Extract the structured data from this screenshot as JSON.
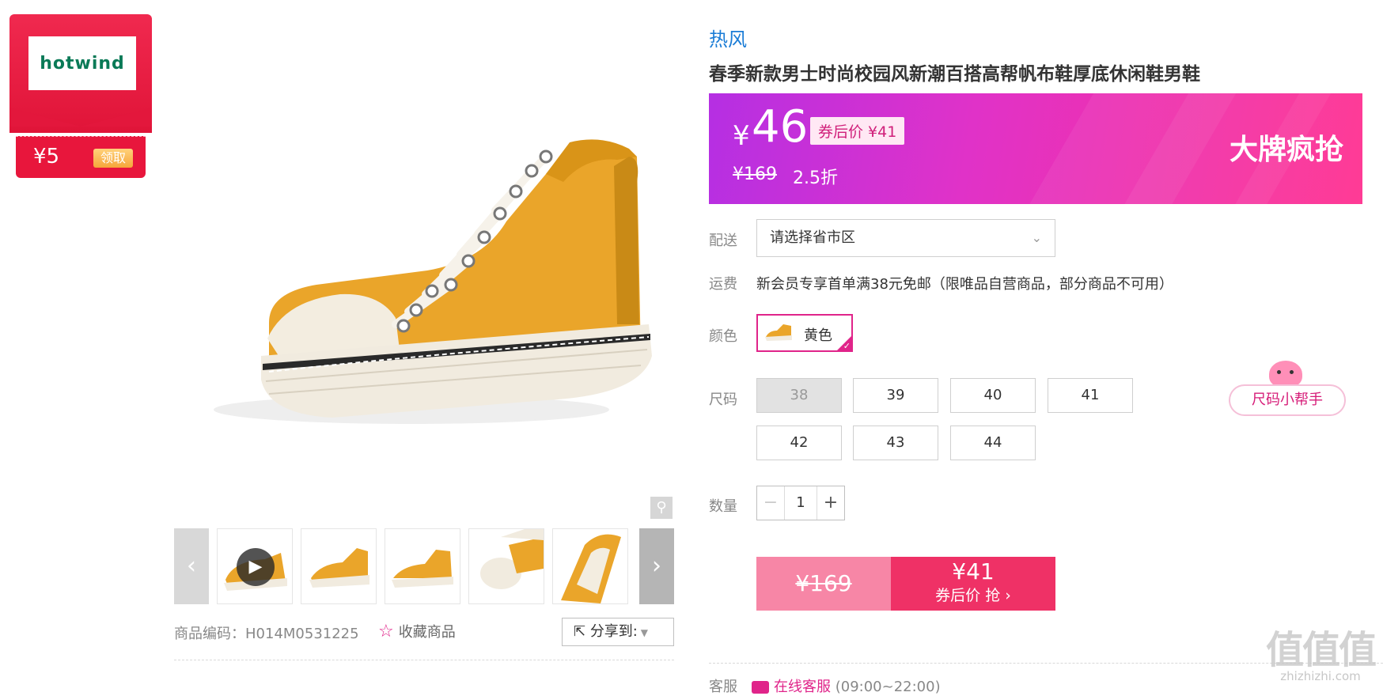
{
  "coupon": {
    "logo": "hotwind",
    "amount": "¥5",
    "claim_label": "领取"
  },
  "product": {
    "brand": "热风",
    "title": "春季新款男士时尚校园风新潮百搭高帮帆布鞋厚底休闲鞋男鞋",
    "sku_label": "商品编码：H014M0531225",
    "favorite_label": "收藏商品",
    "share_label": "分享到:"
  },
  "price": {
    "currency": "¥",
    "current": "46",
    "after_coupon": "券后价 ¥41",
    "original": "¥169",
    "discount": "2.5折",
    "slogan": "大牌疯抢"
  },
  "delivery": {
    "label": "配送",
    "placeholder": "请选择省市区"
  },
  "shipping": {
    "label": "运费",
    "text": "新会员专享首单满38元免邮（限唯品自营商品，部分商品不可用）"
  },
  "color": {
    "label": "颜色",
    "selected": "黄色"
  },
  "size": {
    "label": "尺码",
    "options": [
      "38",
      "39",
      "40",
      "41",
      "42",
      "43",
      "44"
    ],
    "disabled": [
      "38"
    ],
    "helper_label": "尺码小帮手"
  },
  "quantity": {
    "label": "数量",
    "value": "1",
    "minus": "−",
    "plus": "+"
  },
  "buy": {
    "original": "¥169",
    "price": "¥41",
    "action": "券后价 抢 ›"
  },
  "service": {
    "label": "客服",
    "link": "在线客服",
    "hours": "(09:00~22:00)"
  },
  "watermark": {
    "logo": "值值值",
    "site": "zhizhizhi.com"
  },
  "colors": {
    "accent": "#e0248a",
    "brand_blue": "#1a7cd6",
    "shoe_yellow": "#eaa52a",
    "buy_red": "#ef3166"
  }
}
